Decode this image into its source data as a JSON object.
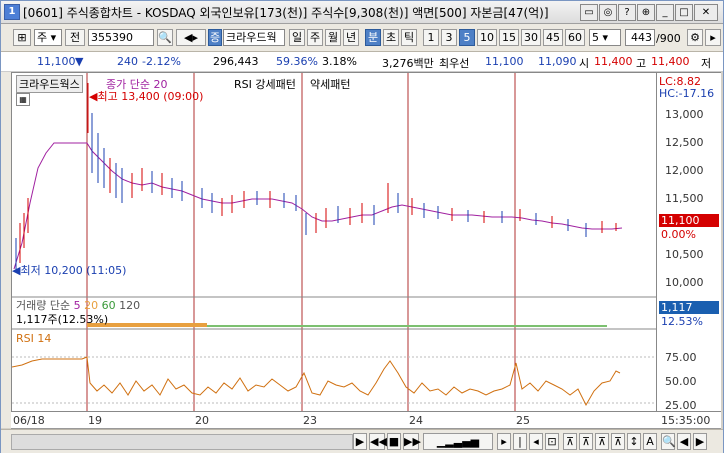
{
  "window": {
    "title": "[0601] 주식종합차트 - KOSDAQ 외국인보유[173(천)] 주식수[9,308(천)] 액면[500] 자본금[47(억)]"
  },
  "toolbar": {
    "market": "주",
    "all": "전",
    "code": "355390",
    "stock_name": "크라우드웍",
    "periods": [
      "일",
      "주",
      "월",
      "년",
      "분",
      "초",
      "틱"
    ],
    "intervals": [
      "1",
      "3",
      "5",
      "10",
      "15",
      "30",
      "45",
      "60"
    ],
    "interval_value": "5",
    "count": "443",
    "count_total": "/900"
  },
  "info": {
    "price": "11,100",
    "change": "240",
    "change_pct": "-2.12%",
    "volume": "296,443",
    "vol_pct": "59.36%",
    "turnover": "3.18%",
    "amount": "3,276백만",
    "best_ask_label": "최우선",
    "ask": "11,100",
    "bid": "11,090",
    "open_label": "시",
    "open": "11,400",
    "high_label": "고",
    "high": "11,400",
    "low_label": "저"
  },
  "legend": {
    "name": "크라우드웍스",
    "ma_label": "종가 단순 20",
    "rsi_label": "RSI 강세패턴",
    "weak_label": "약세패턴"
  },
  "annotations": {
    "high": "최고 13,400 (09:00)",
    "low": "최저 10,200 (11:05)"
  },
  "axis": {
    "lc": "LC:8.82",
    "hc": "HC:-17.16",
    "price_ticks": [
      "13,000",
      "12,500",
      "12,000",
      "11,500",
      "11,000",
      "10,500",
      "10,000"
    ],
    "last_price": "11,100",
    "last_pct": "0.00%",
    "volume_label": "1,117",
    "volume_pct": "12.53%",
    "rsi_ticks": [
      "75.00",
      "50.00",
      "25.00"
    ]
  },
  "volume_legend": {
    "name": "거래량",
    "type": "단순",
    "ma5": "5",
    "ma20": "20",
    "ma60": "60",
    "ma120": "120",
    "current": "1,117주(12.53%)"
  },
  "rsi_legend": {
    "name": "RSI 14"
  },
  "xaxis": {
    "labels": [
      "06/18",
      "19",
      "20",
      "23",
      "24",
      "25"
    ],
    "time": "15:35:00"
  },
  "colors": {
    "up": "#d40000",
    "down": "#1a3fb0",
    "ma": "#a020a0",
    "rsi": "#d07010",
    "sel": "#4e80c6"
  }
}
